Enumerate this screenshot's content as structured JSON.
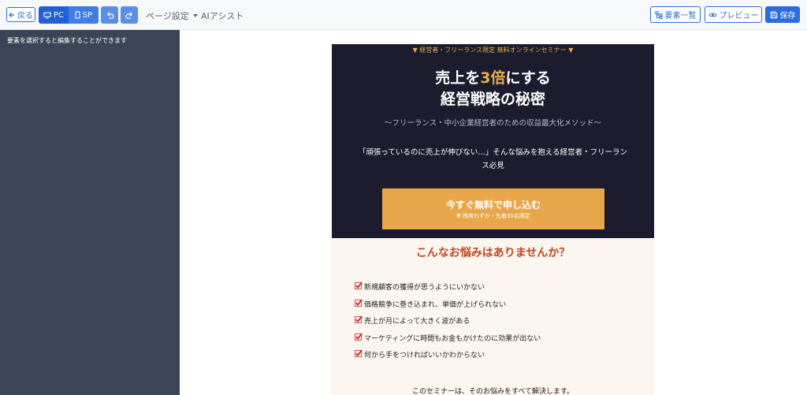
{
  "toolbar": {
    "back_label": "戻る",
    "view_pc_label": "PC",
    "view_sp_label": "SP",
    "undo_icon": "undo-icon",
    "redo_icon": "redo-icon",
    "page_settings_label": "ページ設定",
    "ai_assist_label": "AIアシスト",
    "element_list_label": "要素一覧",
    "preview_label": "プレビュー",
    "save_label": "保存"
  },
  "sidebar": {
    "hint": "要素を選択すると編集することができます"
  },
  "lp": {
    "badge": "▼ 経営者・フリーランス限定 無料オンラインセミナー ▼",
    "headline_pre": "売上を",
    "headline_accent": "3倍",
    "headline_post": "にする",
    "headline_line2": "経営戦略の秘密",
    "subtitle": "〜フリーランス・中小企業経営者のための収益最大化メソッド〜",
    "lead": "「頑張っているのに売上が伸びない…」そんな悩みを抱える経営者・フリーランス必見",
    "cta_label": "今すぐ無料で申し込む",
    "cta_note": "▼ 残席わずか・先着30名限定",
    "pain_title": "こんなお悩みはありませんか？",
    "pain_points": [
      "新規顧客の獲得が思うようにいかない",
      "価格競争に巻き込まれ、単価が上げられない",
      "売上が月によって大きく波がある",
      "マーケティングに時間もお金もかけたのに効果が出ない",
      "何から手をつければいいかわからない"
    ],
    "closing": "このセミナーは、そのお悩みをすべて解決します。"
  },
  "colors": {
    "primary": "#2b6ce0",
    "sidebar_bg": "#3a4658",
    "hero_bg": "#1c1c2e",
    "accent_gold": "#e8b04c",
    "cta_bg": "#e8a74a",
    "pain_title": "#c2451d",
    "check_red": "#d0202a"
  }
}
